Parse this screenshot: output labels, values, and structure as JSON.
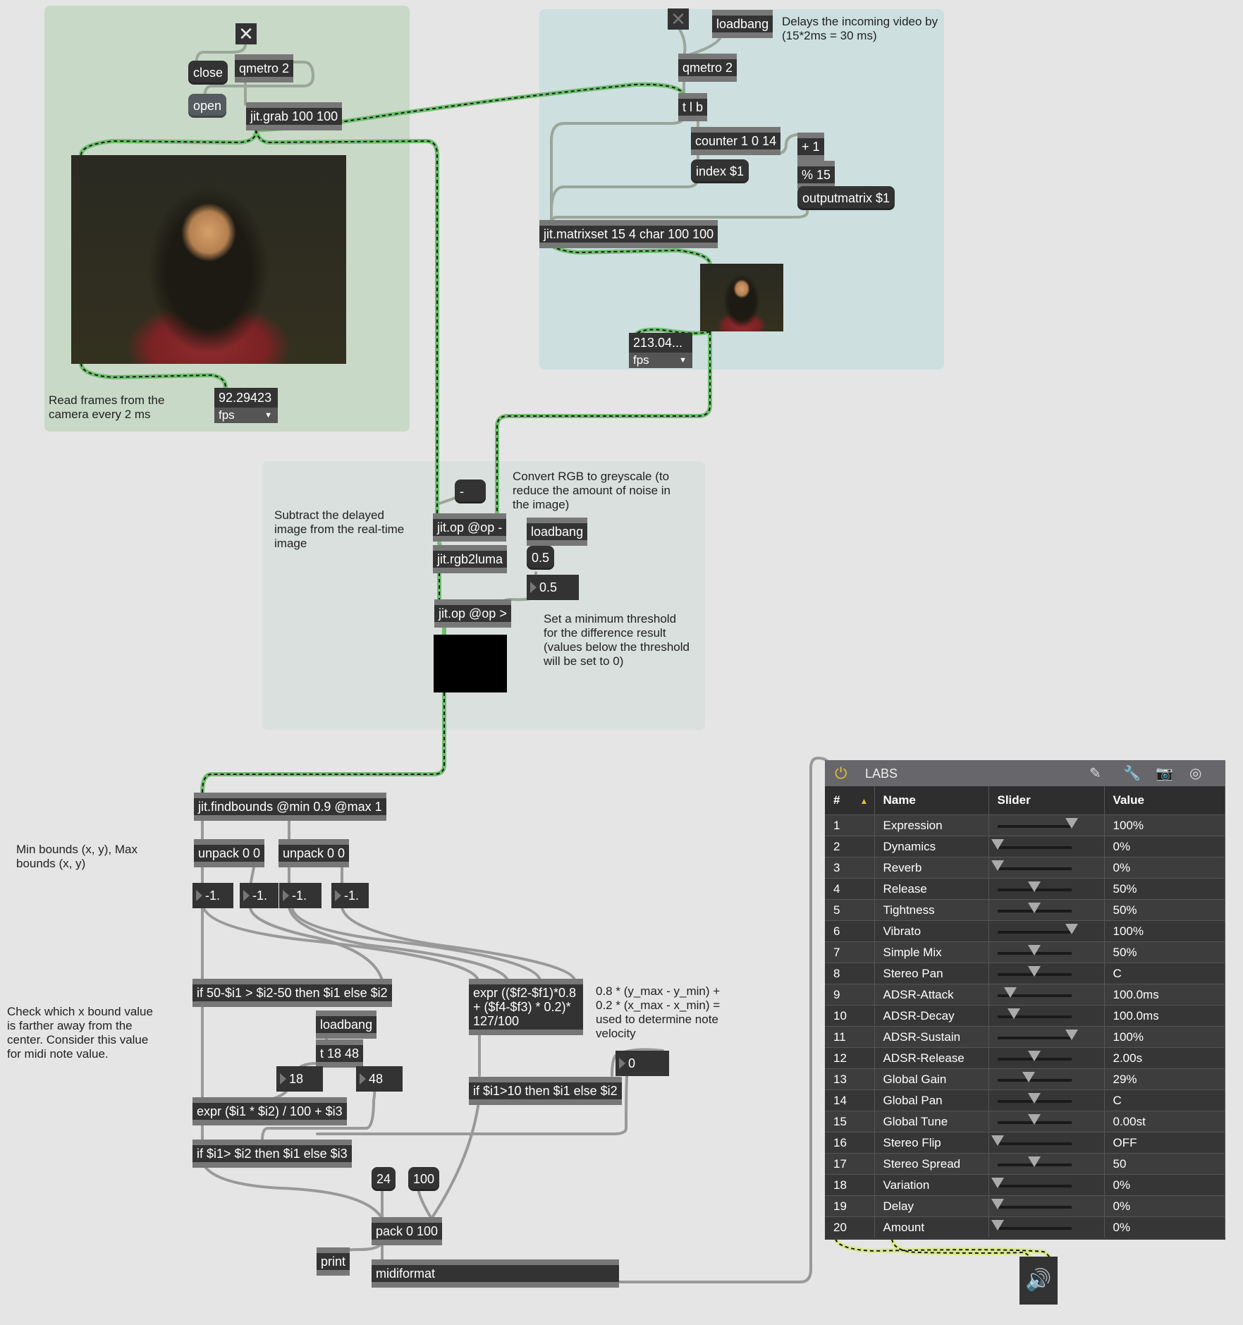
{
  "panels": {
    "capture": {
      "toggle_icon": "close-x-icon",
      "close_label": "close",
      "open_label": "open",
      "qmetro": "qmetro 2",
      "grab": "jit.grab 100 100",
      "fps_value": "92.29423",
      "fps_unit": "fps",
      "comment": "Read frames from the camera every 2 ms"
    },
    "delay": {
      "toggle_icon": "close-x-icon",
      "loadbang": "loadbang",
      "comment": "Delays the incoming video by (15*2ms = 30 ms)",
      "qmetro": "qmetro 2",
      "trigger": "t l b",
      "counter": "counter 1 0 14",
      "index_msg": "index $1",
      "plus": "+ 1",
      "mod": "% 15",
      "outputmatrix_msg": "outputmatrix $1",
      "matrixset": "jit.matrixset 15 4 char 100 100",
      "fps_value": "213.04...",
      "fps_unit": "fps"
    },
    "difference": {
      "minus_msg": "-",
      "op_minus": "jit.op @op -",
      "rgb2luma": "jit.rgb2luma",
      "op_gt": "jit.op @op >",
      "loadbang": "loadbang",
      "threshold_msg": "0.5",
      "threshold_num": "0.5",
      "comment_subtract": "Subtract the delayed image from the real-time image",
      "comment_greyscale": "Convert RGB to greyscale (to reduce the amount of noise in the image)",
      "comment_threshold": "Set a minimum threshold for the difference result (values below the threshold will be set to 0)"
    }
  },
  "analysis": {
    "findbounds": "jit.findbounds @min 0.9 @max 1",
    "unpack1": "unpack 0 0",
    "unpack2": "unpack 0 0",
    "bounds_nums": [
      "-1.",
      "-1.",
      "-1.",
      "-1."
    ],
    "comment_bounds": "Min bounds (x, y), Max bounds (x, y)",
    "if_x": "if 50-$i1 > $i2-50 then $i1 else $i2",
    "comment_x": "Check which x bound value is farther away from the center. Consider this value for midi note value.",
    "loadbang": "loadbang",
    "trigger": "t 18 48",
    "num_18": "18",
    "num_48": "48",
    "expr_note": "expr ($i1 * $i2) / 100 + $i3",
    "if_note": "if $i1> $i2 then $i1 else $i3",
    "expr_velocity": "expr (($f2-$f1)*0.8 + ($f4-$f3) * 0.2)* 127/100",
    "comment_velocity": "0.8 * (y_max - y_min) + 0.2 * (x_max - x_min) = used to determine note velocity",
    "velocity_num": "0",
    "if_velocity": "if $i1>10 then $i1 else $i2",
    "msg_24": "24",
    "msg_100": "100",
    "pack": "pack 0 100",
    "print": "print",
    "midiformat": "midiformat"
  },
  "labs": {
    "title": "LABS",
    "power_icon": "power-icon",
    "header_icons": [
      "pencil-icon",
      "wrench-icon",
      "camera-icon",
      "spitfire-logo-icon"
    ],
    "columns": [
      "#",
      "Name",
      "Slider",
      "Value"
    ],
    "sort_indicator": "▲",
    "rows": [
      {
        "num": "1",
        "name": "Expression",
        "slider": 1.0,
        "value": "100%"
      },
      {
        "num": "2",
        "name": "Dynamics",
        "slider": 0.0,
        "value": "0%"
      },
      {
        "num": "3",
        "name": "Reverb",
        "slider": 0.0,
        "value": "0%"
      },
      {
        "num": "4",
        "name": "Release",
        "slider": 0.5,
        "value": "50%"
      },
      {
        "num": "5",
        "name": "Tightness",
        "slider": 0.5,
        "value": "50%"
      },
      {
        "num": "6",
        "name": "Vibrato",
        "slider": 1.0,
        "value": "100%"
      },
      {
        "num": "7",
        "name": "Simple Mix",
        "slider": 0.5,
        "value": "50%"
      },
      {
        "num": "8",
        "name": "Stereo Pan",
        "slider": 0.5,
        "value": "C"
      },
      {
        "num": "9",
        "name": "ADSR-Attack",
        "slider": 0.18,
        "value": "100.0ms"
      },
      {
        "num": "10",
        "name": "ADSR-Decay",
        "slider": 0.22,
        "value": "100.0ms"
      },
      {
        "num": "11",
        "name": "ADSR-Sustain",
        "slider": 1.0,
        "value": "100%"
      },
      {
        "num": "12",
        "name": "ADSR-Release",
        "slider": 0.5,
        "value": "2.00s"
      },
      {
        "num": "13",
        "name": "Global Gain",
        "slider": 0.42,
        "value": "29%"
      },
      {
        "num": "14",
        "name": "Global Pan",
        "slider": 0.5,
        "value": "C"
      },
      {
        "num": "15",
        "name": "Global Tune",
        "slider": 0.5,
        "value": "0.00st"
      },
      {
        "num": "16",
        "name": "Stereo Flip",
        "slider": 0.0,
        "value": "OFF"
      },
      {
        "num": "17",
        "name": "Stereo Spread",
        "slider": 0.5,
        "value": "50"
      },
      {
        "num": "18",
        "name": "Variation",
        "slider": 0.0,
        "value": "0%"
      },
      {
        "num": "19",
        "name": "Delay",
        "slider": 0.0,
        "value": "0%"
      },
      {
        "num": "20",
        "name": "Amount",
        "slider": 0.0,
        "value": "0%"
      }
    ]
  },
  "output": {
    "speaker_icon": "speaker-icon"
  },
  "colors": {
    "green_panel": "#c9d9c7",
    "blue_panel": "#cddfdf",
    "grey_panel": "#dae0de",
    "matrix_cable": "#6fbf6f",
    "audio_cable": "#d8e88a",
    "labs_accent": "#e2c033"
  }
}
